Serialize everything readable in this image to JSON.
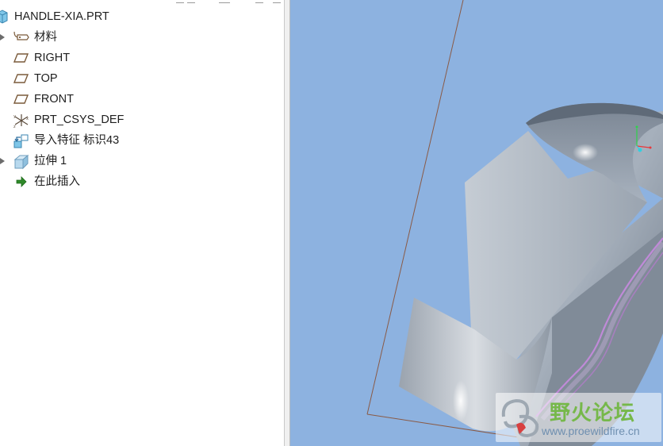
{
  "model_tree": {
    "root": {
      "label": "HANDLE-XIA.PRT",
      "icon": "part-icon"
    },
    "items": [
      {
        "label": "材料",
        "icon": "material-tag-icon",
        "expandable": true
      },
      {
        "label": "RIGHT",
        "icon": "datum-plane-icon",
        "expandable": false
      },
      {
        "label": "TOP",
        "icon": "datum-plane-icon",
        "expandable": false
      },
      {
        "label": "FRONT",
        "icon": "datum-plane-icon",
        "expandable": false
      },
      {
        "label": "PRT_CSYS_DEF",
        "icon": "coordinate-system-icon",
        "expandable": false
      },
      {
        "label": "导入特征 标识43",
        "icon": "import-feature-icon",
        "expandable": false
      },
      {
        "label": "拉伸 1",
        "icon": "extrude-icon",
        "expandable": true
      },
      {
        "label": "在此插入",
        "icon": "insert-here-arrow-icon",
        "expandable": false
      }
    ]
  },
  "viewport": {
    "background_color": "#8db2e0",
    "model_color": "#a9b3bf",
    "highlight_color": "#c08ad8",
    "datum_line_color": "#8a5a45"
  },
  "watermark": {
    "title": "野火论坛",
    "url": "www.proewildfire.cn"
  }
}
